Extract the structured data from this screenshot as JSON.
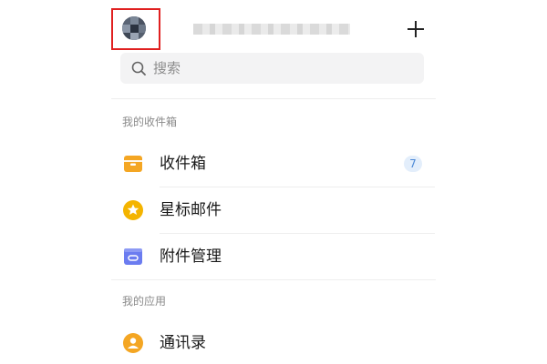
{
  "header": {
    "avatar_icon": "user-avatar",
    "add_icon": "plus-icon"
  },
  "search": {
    "placeholder": "搜索",
    "icon": "search-icon"
  },
  "sections": {
    "mailbox_title": "我的收件箱",
    "apps_title": "我的应用"
  },
  "mailbox_items": [
    {
      "label": "收件箱",
      "icon": "inbox-icon",
      "badge": "7",
      "color": "#f4a623"
    },
    {
      "label": "星标邮件",
      "icon": "star-icon",
      "color": "#f4b400"
    },
    {
      "label": "附件管理",
      "icon": "attachment-folder-icon",
      "color": "#6b7cf0"
    }
  ],
  "app_items": [
    {
      "label": "通讯录",
      "icon": "contacts-icon",
      "color": "#f4a623"
    }
  ],
  "colors": {
    "highlight": "#e02020",
    "badge_bg": "#e3eefb",
    "badge_text": "#4a87d6"
  }
}
